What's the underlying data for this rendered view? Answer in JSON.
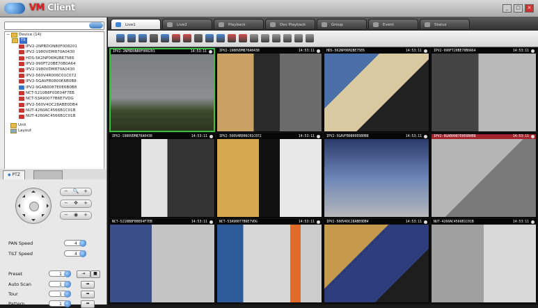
{
  "app": {
    "title_prefix": "VM",
    "title_rest": "Client"
  },
  "window_buttons": [
    "_",
    "□",
    "×"
  ],
  "tree": {
    "root": "Device (14)",
    "group": "Tll",
    "cameras": [
      "IPV2-2NPBDON80F008201",
      "IPV2-1980VDM870A0430",
      "HDS-5K2NP06M2BE75E6",
      "IPV2-990FT20BE70B0A64",
      "IPV2-1980VDM870A0430",
      "IPV2-560V4R006C01C072",
      "IPV2-5GAVFB0800E6B0B8",
      "IPV2-9GAB0087E0E6B0B8",
      "NCT-5210B8F00E04F7EB",
      "NCT-53A90077B6E7VDG",
      "IPV2-560V4OC28ABE0DB4",
      "NUT-4260AC4566B1C01B",
      "NUT-4260AC4566B1C01B"
    ],
    "footer_items": [
      "Unit",
      "Layout"
    ]
  },
  "ptz": {
    "tab_label": "PTZ",
    "pan_label": "PAN Speed",
    "pan_value": "4",
    "tilt_label": "TILT Speed",
    "tilt_value": "4",
    "preset_label": "Preset",
    "preset_value": "1",
    "autoscan_label": "Auto Scan",
    "autoscan_value": "1",
    "tour_label": "Tour",
    "tour_value": "1",
    "pattern_label": "Pattern",
    "pattern_value": "1"
  },
  "tabs": [
    "Live1",
    "Live2",
    "Playback",
    "Dev Playback",
    "Group",
    "Event",
    "Status"
  ],
  "cells": [
    {
      "caption": "IPV2-2NPBDON80F008201",
      "time": "14:53:11"
    },
    {
      "caption": "IPV2-1980VDM870A0430",
      "time": "14:53:11"
    },
    {
      "caption": "HDS-5K2NP06M2BE75E6",
      "time": "14:53:11"
    },
    {
      "caption": "IPV2-990FT20BE70B0A64",
      "time": "14:53:11"
    },
    {
      "caption": "IPV2-1980VDM870A0430",
      "time": "14:53:11"
    },
    {
      "caption": "IPV2-560V4R006C01C072",
      "time": "14:53:11"
    },
    {
      "caption": "IPV2-5GAVFB0800E6B0B8",
      "time": "14:53:11"
    },
    {
      "caption": "IPV2-9GAB0087E0E6B0B8",
      "time": "14:53:11"
    },
    {
      "caption": "NCT-5210B8F00E04F7EB",
      "time": "14:53:11"
    },
    {
      "caption": "NCT-53A90077B6E7VDG",
      "time": "14:53:11"
    },
    {
      "caption": "IPV2-560V4OC28ABE0DB4",
      "time": "14:53:11"
    },
    {
      "caption": "NUT-4260AC4566B1C01B",
      "time": "14:53:11"
    }
  ],
  "colors": {
    "accent": "#3a6dc4",
    "selected_border": "#3fbf3f",
    "alert": "#be2832"
  }
}
